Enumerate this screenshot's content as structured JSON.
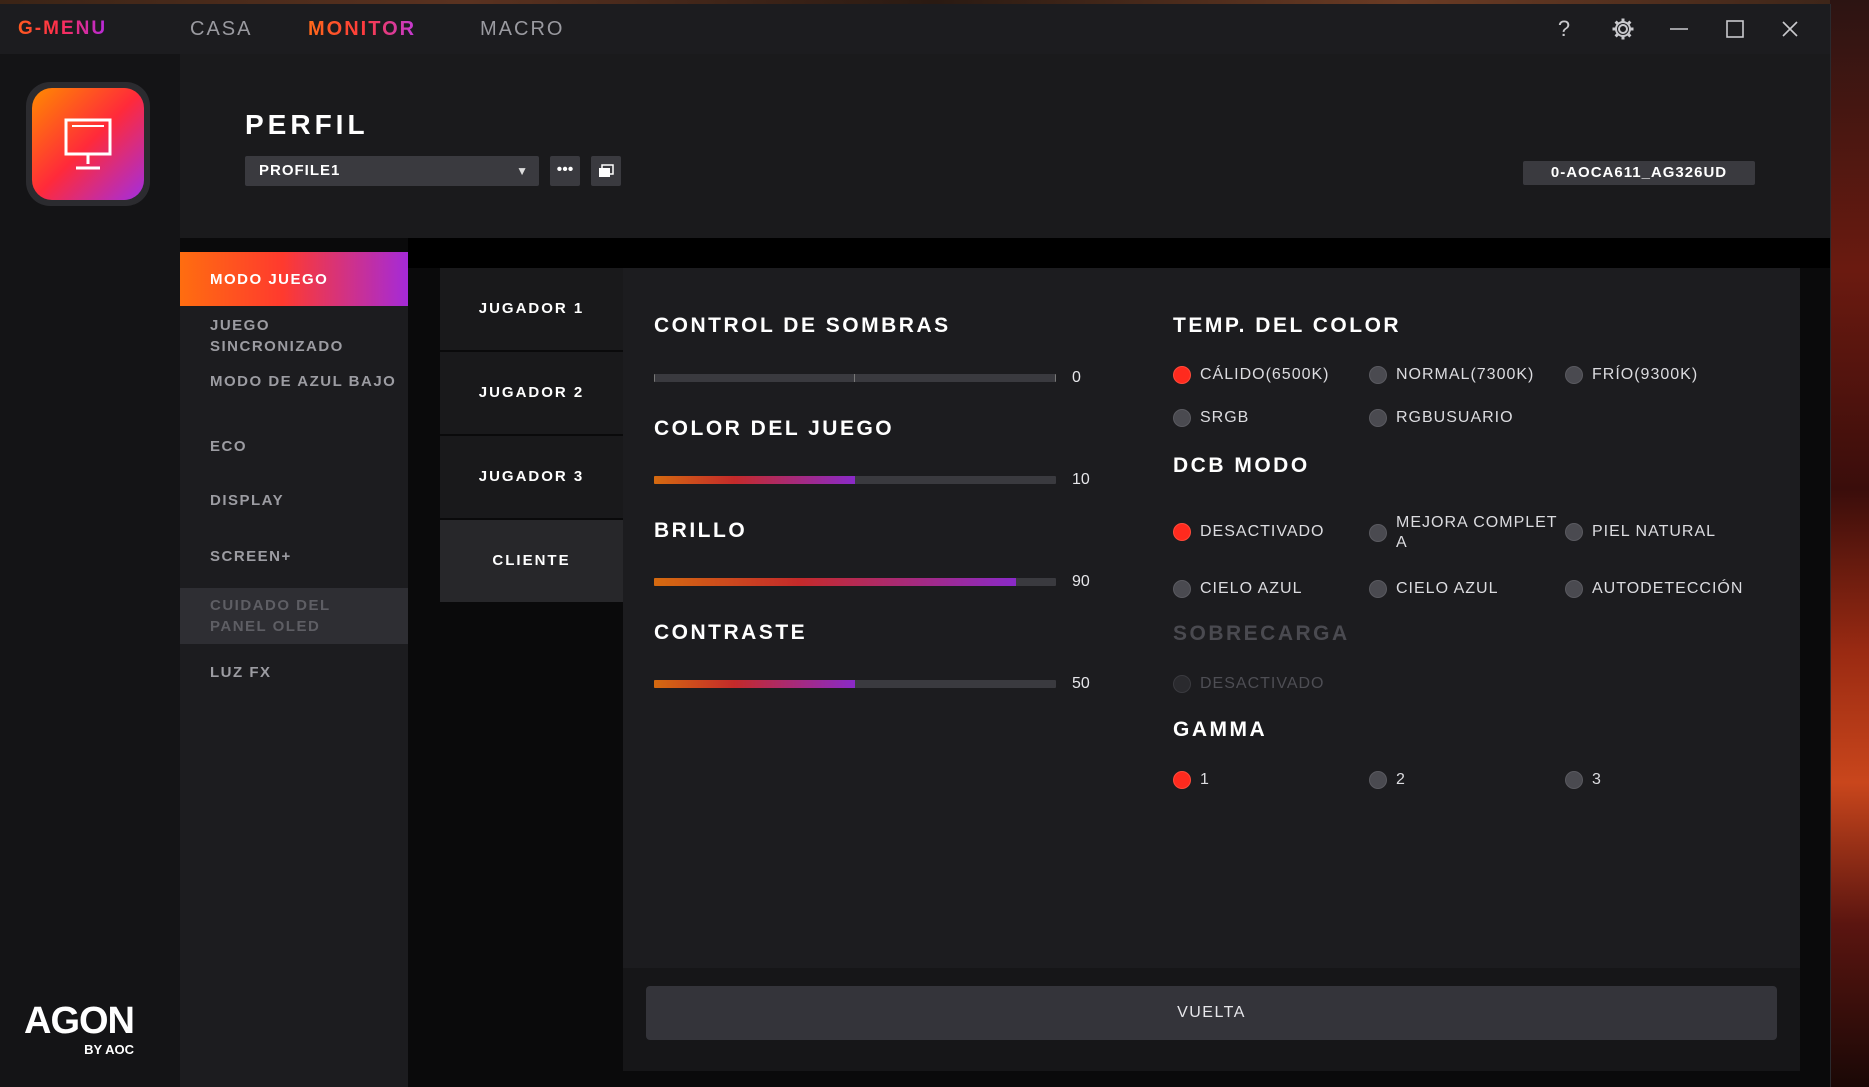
{
  "app": {
    "brand": "G-MENU"
  },
  "nav": {
    "casa": "CASA",
    "monitor": "MONITOR",
    "macro": "MACRO"
  },
  "window_controls": {
    "help": "?",
    "settings_icon": "gear-icon",
    "minimize_icon": "minimize-icon",
    "maximize_icon": "maximize-icon",
    "close_icon": "close-icon"
  },
  "logo": {
    "main": "AGON",
    "sub": "BY AOC"
  },
  "header": {
    "title": "PERFIL",
    "profile_value": "PROFILE1",
    "model": "0-AOCA611_AG326UD"
  },
  "menu": {
    "items": [
      {
        "label": "MODO JUEGO"
      },
      {
        "label": "JUEGO SINCRONIZADO"
      },
      {
        "label": "MODO DE AZUL BAJO"
      },
      {
        "label": "ECO"
      },
      {
        "label": "DISPLAY"
      },
      {
        "label": "SCREEN+"
      },
      {
        "label": "CUIDADO DEL PANEL OLED"
      },
      {
        "label": "LUZ FX"
      }
    ]
  },
  "players": [
    "JUGADOR 1",
    "JUGADOR 2",
    "JUGADOR 3",
    "CLIENTE"
  ],
  "sliders": {
    "shadow": {
      "label": "CONTROL DE SOMBRAS",
      "value": "0",
      "fill_percent": 0
    },
    "game_color": {
      "label": "COLOR DEL JUEGO",
      "value": "10",
      "fill_percent": 50
    },
    "brightness": {
      "label": "BRILLO",
      "value": "90",
      "fill_percent": 90
    },
    "contrast": {
      "label": "CONTRASTE",
      "value": "50",
      "fill_percent": 50
    }
  },
  "color_temp": {
    "title": "TEMP. DEL COLOR",
    "options": [
      "CÁLIDO(6500K)",
      "NORMAL(7300K)",
      "FRÍO(9300K)",
      "SRGB",
      "RGBUSUARIO"
    ],
    "selected": "CÁLIDO(6500K)"
  },
  "dcb": {
    "title": "DCB MODO",
    "options": [
      "DESACTIVADO",
      "MEJORA COMPLET",
      "A",
      "PIEL NATURAL",
      "CIELO AZUL",
      "CIELO AZUL",
      "AUTODETECCIÓN"
    ],
    "selected": "DESACTIVADO"
  },
  "overdrive": {
    "title": "SOBRECARGA",
    "option": "DESACTIVADO"
  },
  "gamma": {
    "title": "GAMMA",
    "options": [
      "1",
      "2",
      "3"
    ],
    "selected": "1"
  },
  "footer": {
    "back_label": "VUELTA"
  },
  "colors": {
    "accent_orange": "#ff6d10",
    "accent_red": "#ff2a1e",
    "accent_purple": "#a52ad8"
  }
}
